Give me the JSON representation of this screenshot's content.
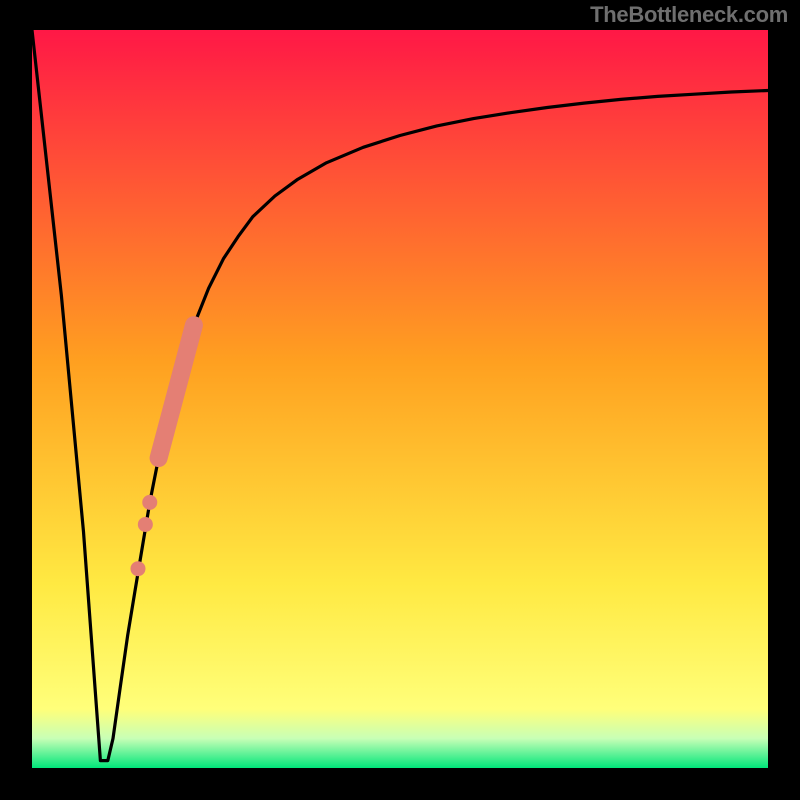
{
  "watermark": "TheBottleneck.com",
  "colors": {
    "gradient_top": "#ff1846",
    "gradient_mid_orange": "#ffa020",
    "gradient_yellow": "#ffe942",
    "gradient_green_pale": "#c8ffb6",
    "gradient_green": "#00e67a",
    "curve_stroke": "#000000",
    "frame": "#000000",
    "marker_fill": "#e47f74"
  },
  "chart_data": {
    "type": "line",
    "title": "",
    "xlabel": "",
    "ylabel": "",
    "xlim": [
      0,
      100
    ],
    "ylim": [
      0,
      100
    ],
    "note": "Bottleneck-percentage style curve. One sharp V-notch near x≈9, then rapid asymptotic rise toward ~92. y=0 is optimal (green band at bottom).",
    "series": [
      {
        "name": "bottleneck-curve",
        "x": [
          0,
          4,
          7,
          9.3,
          10.3,
          11,
          12,
          13,
          14,
          15,
          16,
          17,
          18,
          19,
          20,
          22,
          24,
          26,
          28,
          30,
          33,
          36,
          40,
          45,
          50,
          55,
          60,
          65,
          70,
          75,
          80,
          85,
          90,
          95,
          100
        ],
        "values": [
          100,
          64,
          32,
          1.0,
          1.0,
          4,
          11,
          18,
          24,
          30,
          36,
          41,
          46,
          50,
          54,
          60,
          65,
          69,
          72,
          74.7,
          77.5,
          79.7,
          82,
          84.1,
          85.7,
          87,
          88,
          88.8,
          89.5,
          90.1,
          90.6,
          91.0,
          91.3,
          91.6,
          91.8
        ]
      }
    ],
    "markers": {
      "name": "highlighted-range",
      "note": "Salmon bar segment + dots along the rising limb.",
      "bar_segment": {
        "x_start": 17.2,
        "y_start": 42,
        "x_end": 22.0,
        "y_end": 60
      },
      "dots": [
        {
          "x": 16.0,
          "y": 36
        },
        {
          "x": 15.4,
          "y": 33
        },
        {
          "x": 14.4,
          "y": 27
        }
      ]
    }
  }
}
